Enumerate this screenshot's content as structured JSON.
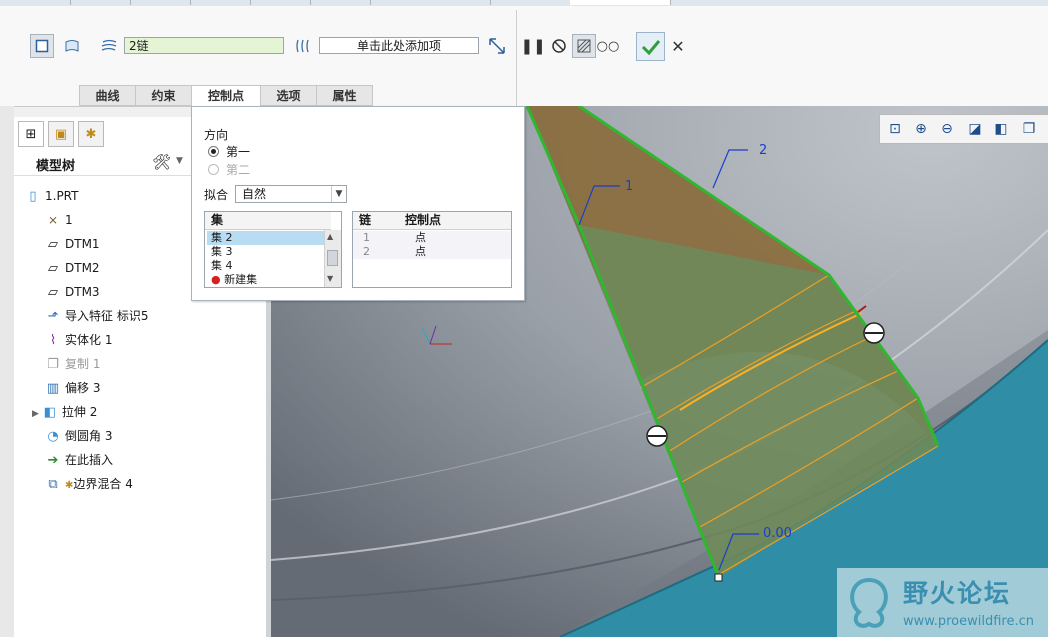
{
  "ribbon": {
    "chain_field_value": "2链",
    "add_field_placeholder": "单击此处添加项",
    "tabs": [
      "曲线",
      "约束",
      "控制点",
      "选项",
      "属性"
    ],
    "active_tab": "控制点"
  },
  "tree": {
    "title": "模型树",
    "items": [
      {
        "label": "1.PRT",
        "icon": "part-icon"
      },
      {
        "label": "1",
        "icon": "csys-icon"
      },
      {
        "label": "DTM1",
        "icon": "datum-plane-icon"
      },
      {
        "label": "DTM2",
        "icon": "datum-plane-icon"
      },
      {
        "label": "DTM3",
        "icon": "datum-plane-icon"
      },
      {
        "label": "导入特征 标识5",
        "icon": "import-feature-icon"
      },
      {
        "label": "实体化 1",
        "icon": "solidify-icon"
      },
      {
        "label": "复制 1",
        "icon": "copy-icon"
      },
      {
        "label": "偏移 3",
        "icon": "offset-icon"
      },
      {
        "label": "拉伸 2",
        "icon": "extrude-icon"
      },
      {
        "label": "倒圆角 3",
        "icon": "round-icon"
      },
      {
        "label": "在此插入",
        "icon": "insert-here-icon"
      },
      {
        "label": "边界混合 4",
        "icon": "boundary-blend-icon"
      }
    ]
  },
  "control_points": {
    "direction_label": "方向",
    "dir_first": "第一",
    "dir_second": "第二",
    "fit_label": "拟合",
    "fit_value": "自然",
    "sets_header": "集",
    "sets": [
      "集 2",
      "集 3",
      "集 4"
    ],
    "new_set": "新建集",
    "chain_header": "链",
    "cp_header": "控制点",
    "chain_rows": [
      {
        "chain": "1",
        "point": "点"
      },
      {
        "chain": "2",
        "point": "点"
      }
    ]
  },
  "viewport": {
    "label_1": "1",
    "label_2": "2",
    "label_value": "0.00",
    "watermark_title": "野火论坛",
    "watermark_url": "www.proewildfire.cn"
  },
  "colors": {
    "surface_edge": "#2fb82f",
    "orange_curves": "#f0a020",
    "accent_check": "#2f9e3a",
    "teal": "#2f8ea6"
  }
}
